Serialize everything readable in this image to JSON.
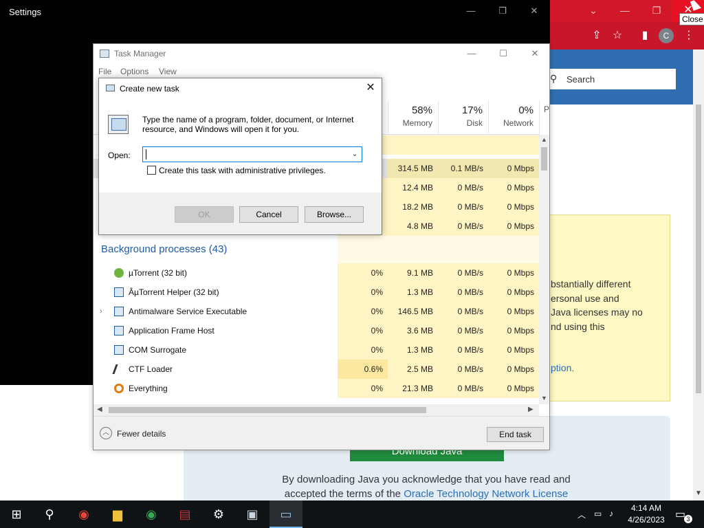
{
  "browser": {
    "tooltip": "Close",
    "avatar_letter": "C",
    "search_placeholder": "Search",
    "notice_lines": [
      "bstantially different",
      "ersonal use and",
      " Java licenses may no",
      "nd using this"
    ],
    "notice_link": "ption.",
    "download_label": "Download Java",
    "legal_line1": "By downloading Java you acknowledge that you have read and",
    "legal_line2_prefix": "accepted the terms of the ",
    "legal_link": "Oracle Technology Network License",
    "colors": {
      "titlebar": "#d01828",
      "header": "#2f6fb1",
      "notice": "#fdf8c4",
      "download": "#1f8a3d"
    }
  },
  "settings": {
    "title": "Settings"
  },
  "taskmgr": {
    "title": "Task Manager",
    "menu": [
      "File",
      "Options",
      "View"
    ],
    "columns": [
      {
        "pct": "58%",
        "label": "Memory"
      },
      {
        "pct": "17%",
        "label": "Disk"
      },
      {
        "pct": "0%",
        "label": "Network"
      },
      {
        "pct": "",
        "label": "P"
      }
    ],
    "apps_rows": [
      {
        "mem": "314.5 MB",
        "disk": "0.1 MB/s",
        "net": "0 Mbps"
      },
      {
        "mem": "12.4 MB",
        "disk": "0 MB/s",
        "net": "0 Mbps"
      },
      {
        "mem": "18.2 MB",
        "disk": "0 MB/s",
        "net": "0 Mbps"
      },
      {
        "mem": "4.8 MB",
        "disk": "0 MB/s",
        "net": "0 Mbps"
      }
    ],
    "background_title": "Background processes (43)",
    "processes": [
      {
        "name": "µTorrent (32 bit)",
        "cpu": "0%",
        "mem": "9.1 MB",
        "disk": "0 MB/s",
        "net": "0 Mbps",
        "icon": "utorrent-icon"
      },
      {
        "name": "ÂµTorrent Helper (32 bit)",
        "cpu": "0%",
        "mem": "1.3 MB",
        "disk": "0 MB/s",
        "net": "0 Mbps",
        "icon": "app-window-icon"
      },
      {
        "name": "Antimalware Service Executable",
        "cpu": "0%",
        "mem": "146.5 MB",
        "disk": "0 MB/s",
        "net": "0 Mbps",
        "icon": "app-window-icon"
      },
      {
        "name": "Application Frame Host",
        "cpu": "0%",
        "mem": "3.6 MB",
        "disk": "0 MB/s",
        "net": "0 Mbps",
        "icon": "app-window-icon"
      },
      {
        "name": "COM Surrogate",
        "cpu": "0%",
        "mem": "1.3 MB",
        "disk": "0 MB/s",
        "net": "0 Mbps",
        "icon": "app-window-icon"
      },
      {
        "name": "CTF Loader",
        "cpu": "0.6%",
        "mem": "2.5 MB",
        "disk": "0 MB/s",
        "net": "0 Mbps",
        "icon": "pen-icon"
      },
      {
        "name": "Everything",
        "cpu": "0%",
        "mem": "21.3 MB",
        "disk": "0 MB/s",
        "net": "0 Mbps",
        "icon": "magnifier-icon"
      }
    ],
    "fewer_details": "Fewer details",
    "end_task": "End task"
  },
  "dialog": {
    "title": "Create new task",
    "description": "Type the name of a program, folder, document, or Internet resource, and Windows will open it for you.",
    "open_label": "Open:",
    "open_value": "",
    "admin_label": "Create this task with administrative privileges.",
    "admin_checked": false,
    "ok": "OK",
    "cancel": "Cancel",
    "browse": "Browse..."
  },
  "taskbar": {
    "time": "4:14 AM",
    "date": "4/26/2023",
    "notification_count": "3"
  }
}
